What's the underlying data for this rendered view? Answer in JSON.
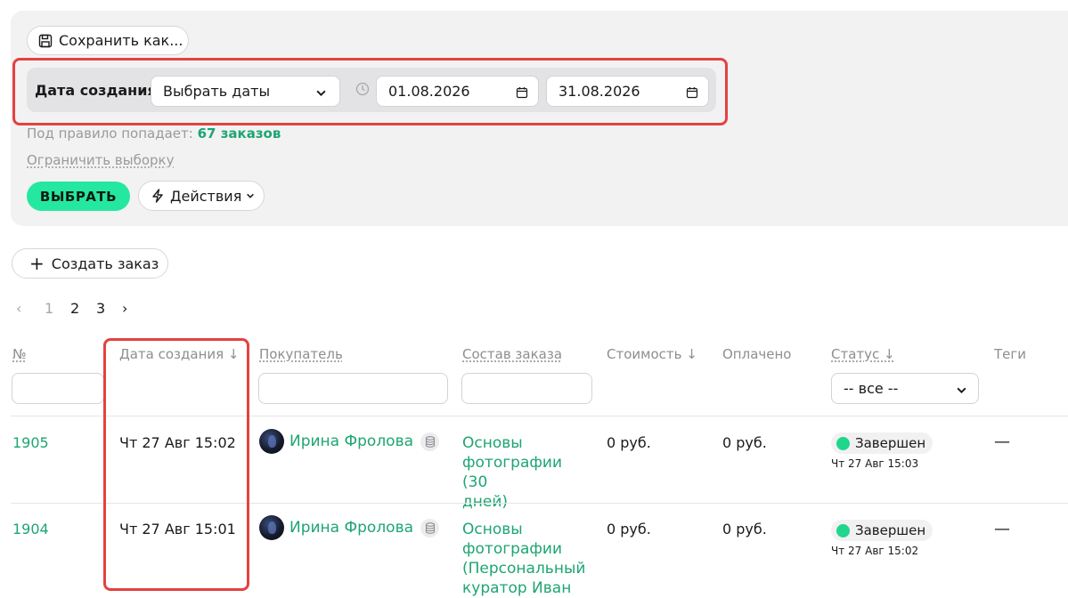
{
  "toolbar": {
    "save_label": "Сохранить как..."
  },
  "rule": {
    "field_label": "Дата создания",
    "period_select": "Выбрать даты",
    "date_from": "01.08.2026",
    "date_to": "31.08.2026"
  },
  "summary": {
    "prefix": "Под правило попадает:",
    "count": "67 заказов"
  },
  "limit_label": "Ограничить выборку",
  "select_button": "ВЫБРАТЬ",
  "actions_button": "Действия",
  "create_order_button": "Создать заказ",
  "pagination": {
    "prev": "‹",
    "pages": [
      "1",
      "2",
      "3"
    ],
    "next": "›"
  },
  "table": {
    "headers": [
      "№",
      "Дата создания ↓",
      "Покупатель",
      "Состав заказа",
      "Стоимость ↓",
      "Оплачено",
      "Статус ↓",
      "Теги"
    ],
    "status_filter": "-- все --",
    "rows": [
      {
        "id": "1905",
        "created": "Чт 27 Авг 15:02",
        "customer": "Ирина Фролова",
        "product_lines": [
          "Основы",
          "фотографии (30",
          "дней)"
        ],
        "cost": "0 руб.",
        "paid": "0 руб.",
        "status": "Завершен",
        "status_time": "Чт 27 Авг 15:03",
        "tags": "—"
      },
      {
        "id": "1904",
        "created": "Чт 27 Авг 15:01",
        "customer": "Ирина Фролова",
        "product_lines": [
          "Основы",
          "фотографии",
          "(Персональный",
          "куратор Иван"
        ],
        "cost": "0 руб.",
        "paid": "0 руб.",
        "status": "Завершен",
        "status_time": "Чт 27 Авг 15:02",
        "tags": "—"
      }
    ]
  },
  "colors": {
    "accent_green": "#1ea572",
    "button_green": "#25e8a0",
    "highlight_red": "#e4423f",
    "status_dot": "#20d68d"
  },
  "icons": [
    "save-icon",
    "chevron-down-icon",
    "clock-icon",
    "calendar-icon",
    "lightning-icon",
    "plus-icon",
    "database-icon"
  ]
}
